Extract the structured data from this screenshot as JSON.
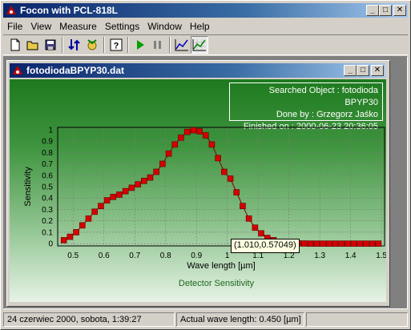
{
  "app": {
    "title": "Focon with PCL-818L"
  },
  "menu": {
    "items": [
      "File",
      "View",
      "Measure",
      "Settings",
      "Window",
      "Help"
    ]
  },
  "toolbar": {
    "tools": [
      "new-file-icon",
      "open-folder-icon",
      "save-icon",
      "calibrate-icon",
      "detector-icon",
      "help-icon",
      "play-icon",
      "pause-icon",
      "chart-line-icon",
      "chart-grid-icon"
    ]
  },
  "child_window": {
    "title": "fotodiodaBPYP30.dat"
  },
  "info": {
    "searched_object": "Searched Object : fotodioda BPYP30",
    "done_by": "Done by : Grzegorz Jaśko",
    "finished_on": "Finished on : 2000-06-23 20:36:05"
  },
  "tooltip": {
    "text": "(1.010,0.57049)"
  },
  "chart_data": {
    "type": "line",
    "title": "Detector Sensitivity",
    "xlabel": "Wave length [µm]",
    "ylabel": "Sensitivity",
    "xlim": [
      0.45,
      1.51
    ],
    "ylim": [
      -0.02,
      1.02
    ],
    "xticks": [
      "0.5",
      "0.6",
      "0.7",
      "0.8",
      "0.9",
      "1",
      "1.1",
      "1.2",
      "1.3",
      "1.4",
      "1.5"
    ],
    "yticks": [
      "0",
      "0.1",
      "0.2",
      "0.3",
      "0.4",
      "0.5",
      "0.6",
      "0.7",
      "0.8",
      "0.9",
      "1"
    ],
    "grid": true,
    "marker_color": "#d40000",
    "series": [
      {
        "x": [
          0.47,
          0.49,
          0.51,
          0.53,
          0.55,
          0.57,
          0.59,
          0.61,
          0.63,
          0.65,
          0.67,
          0.69,
          0.71,
          0.73,
          0.75,
          0.77,
          0.79,
          0.81,
          0.83,
          0.85,
          0.87,
          0.89,
          0.91,
          0.93,
          0.95,
          0.97,
          0.99,
          1.01,
          1.03,
          1.05,
          1.07,
          1.09,
          1.11,
          1.13,
          1.15,
          1.17,
          1.19,
          1.21,
          1.23,
          1.25,
          1.27,
          1.29,
          1.31,
          1.33,
          1.35,
          1.37,
          1.39,
          1.41,
          1.43,
          1.45,
          1.47,
          1.49
        ],
        "y": [
          0.03,
          0.06,
          0.1,
          0.16,
          0.22,
          0.28,
          0.33,
          0.38,
          0.41,
          0.43,
          0.46,
          0.49,
          0.52,
          0.55,
          0.58,
          0.63,
          0.7,
          0.79,
          0.87,
          0.93,
          0.98,
          0.995,
          0.985,
          0.95,
          0.87,
          0.75,
          0.63,
          0.57,
          0.45,
          0.33,
          0.22,
          0.14,
          0.09,
          0.05,
          0.03,
          0.015,
          0.008,
          0.004,
          0.002,
          0.001,
          0.0,
          0.0,
          0.0,
          0.0,
          0.0,
          0.0,
          0.0,
          0.0,
          0.0,
          0.0,
          0.0,
          0.0
        ]
      }
    ]
  },
  "status": {
    "date": "24 czerwiec 2000, sobota, 1:39:27",
    "wave": "Actual wave length: 0.450 [µm]"
  }
}
